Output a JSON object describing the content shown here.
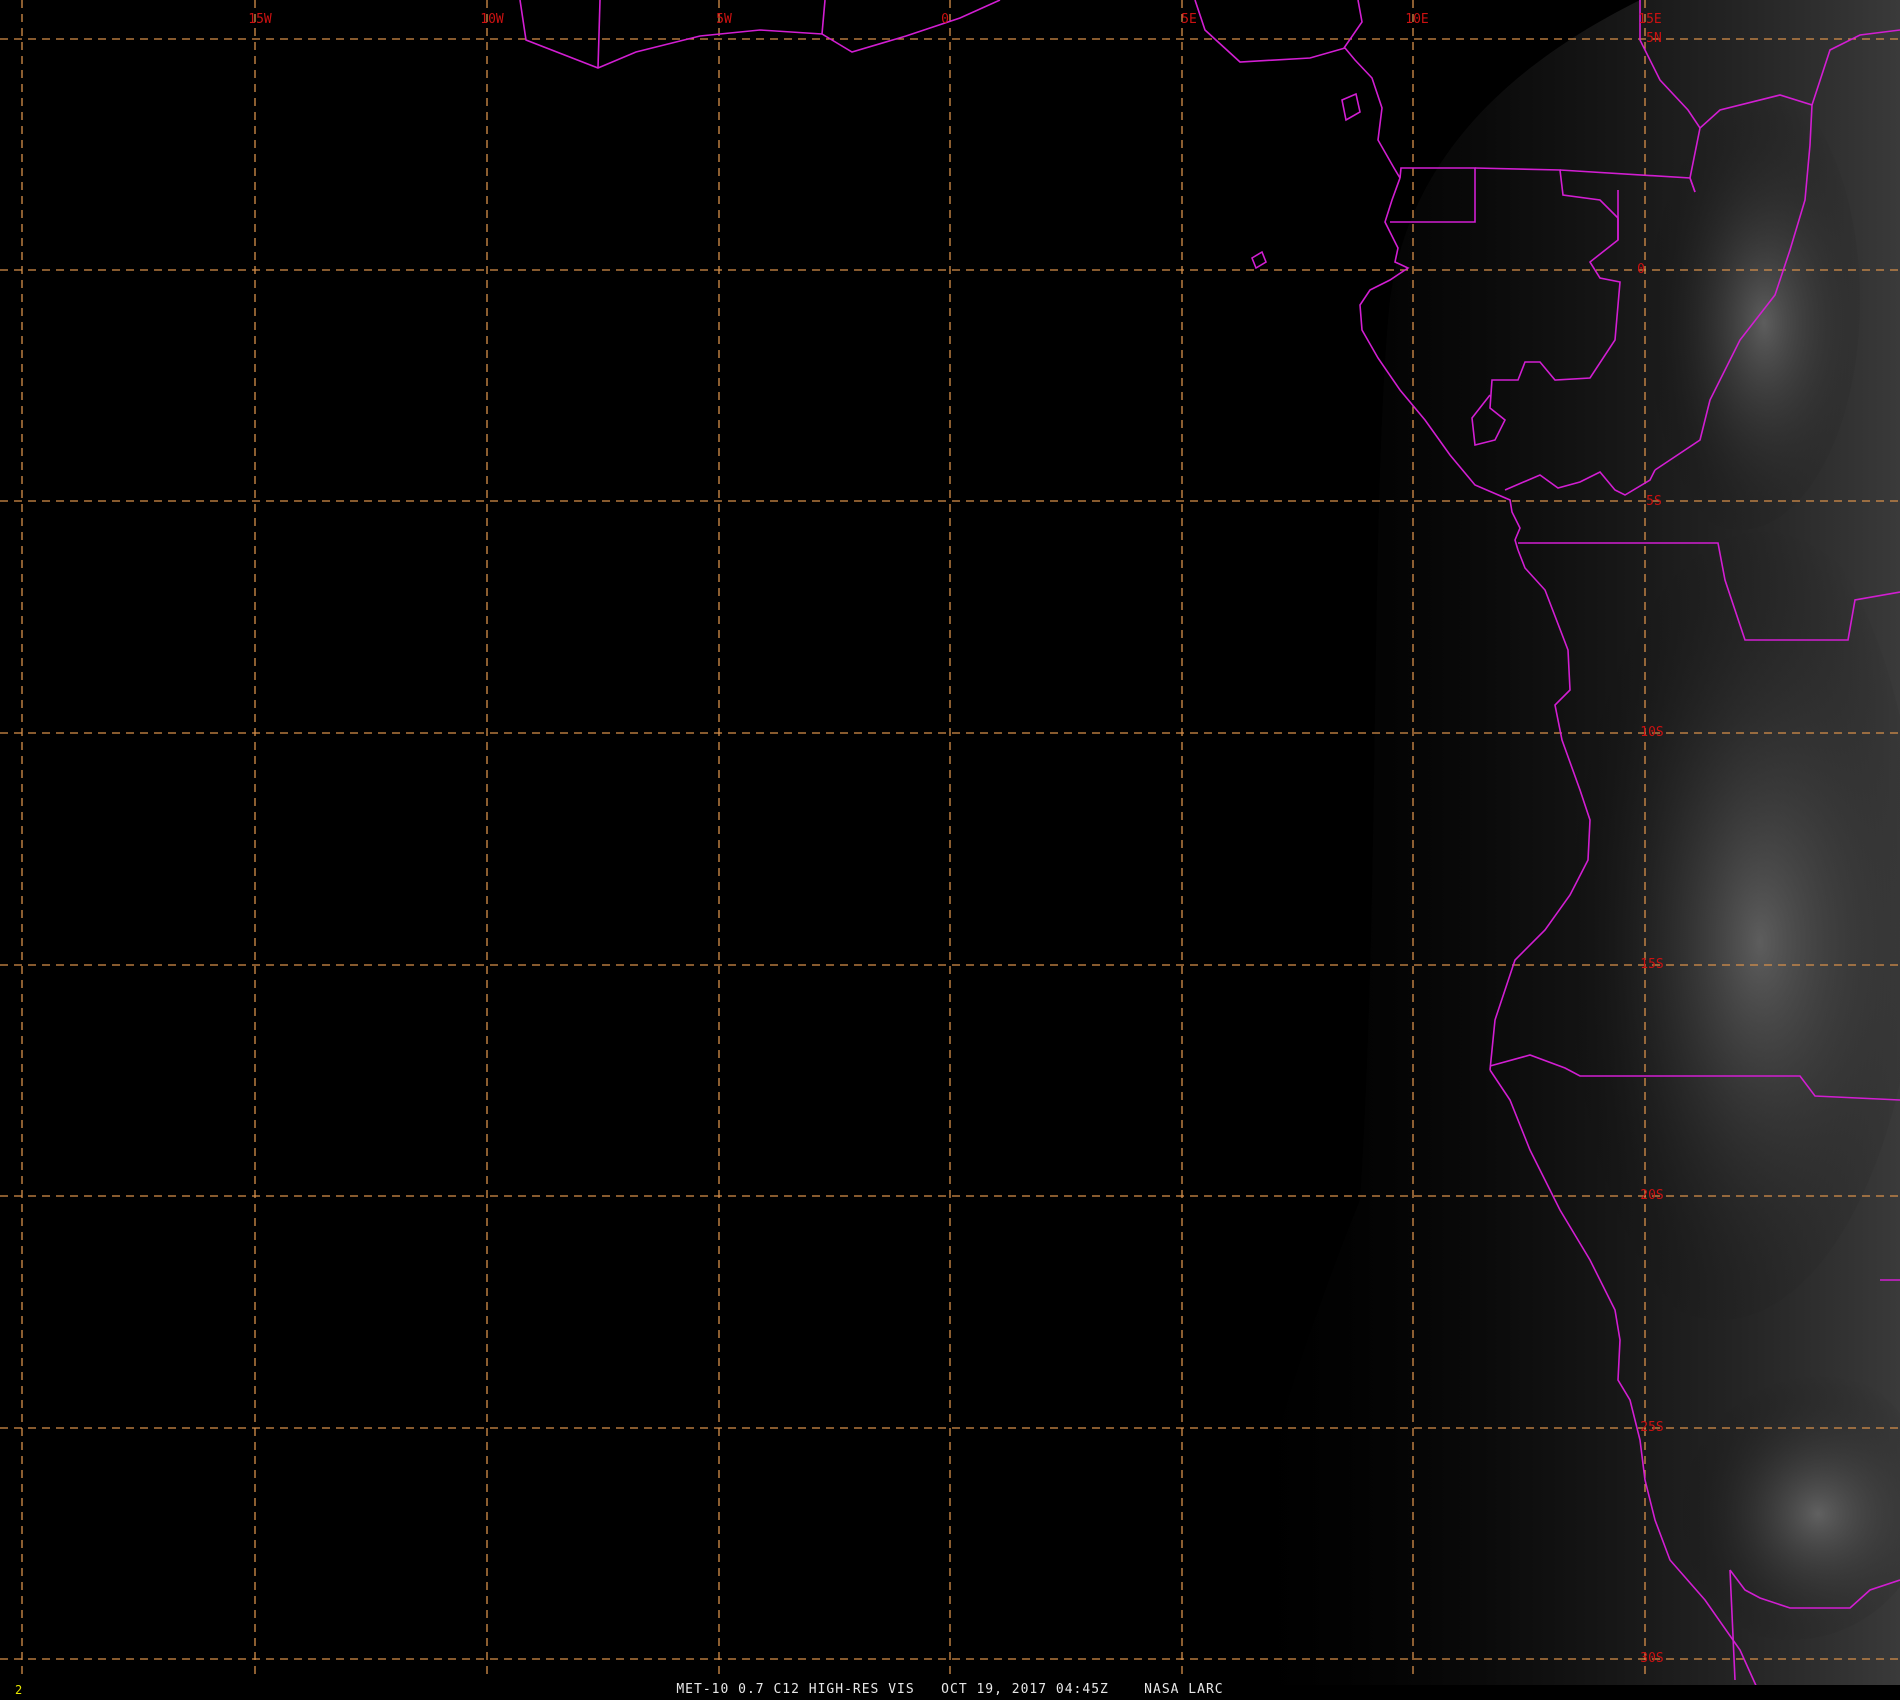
{
  "colors": {
    "background": "#000000",
    "grid": "#d8904a",
    "borders": "#d21ed2",
    "labels": "#cc1111",
    "frame_number": "#e6e600",
    "caption": "#e8e8e8"
  },
  "map": {
    "longitude_labels": [
      "15W",
      "10W",
      "5W",
      "0",
      "5E",
      "10E",
      "15E"
    ],
    "latitude_labels": [
      "5N",
      "0",
      "5S",
      "10S",
      "15S",
      "20S",
      "25S",
      "30S"
    ],
    "caption": "MET-10 0.7 C12 HIGH-RES VIS   OCT 19, 2017 04:45Z    NASA LARC",
    "frame_number": "2"
  }
}
